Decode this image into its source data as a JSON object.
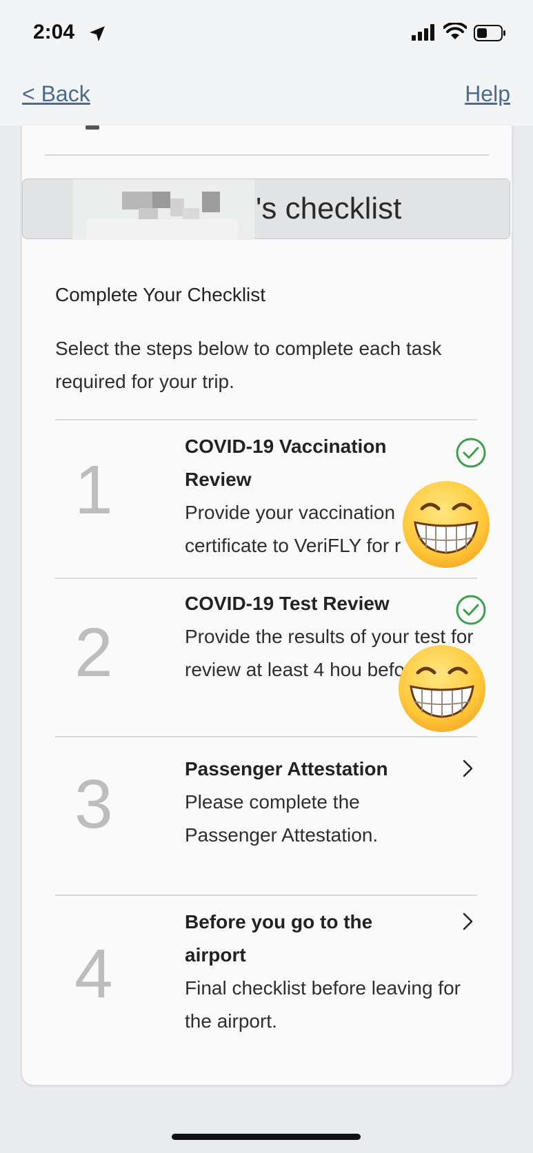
{
  "status_bar": {
    "time": "2:04"
  },
  "nav": {
    "back_label": "< Back",
    "help_label": "Help"
  },
  "header": {
    "title": "'s checklist"
  },
  "section": {
    "title": "Complete Your Checklist",
    "instructions": "Select the steps below to complete each task required for your trip."
  },
  "steps": [
    {
      "number": "1",
      "title": "COVID-19 Vaccination Review",
      "description": "Provide your vaccination certificate to VeriFLY for r",
      "status": "complete"
    },
    {
      "number": "2",
      "title": "COVID-19 Test Review",
      "description": "Provide the results of your test for review at least 4 hou before flight.",
      "status": "complete"
    },
    {
      "number": "3",
      "title": "Passenger Attestation",
      "description": "Please complete the Passenger Attestation.",
      "status": "pending"
    },
    {
      "number": "4",
      "title": "Before you go to the airport",
      "description": "Final checklist before leaving for the airport.",
      "status": "pending"
    }
  ],
  "colors": {
    "accent_link": "#4a6a92",
    "check_green": "#3aa14a",
    "step_number": "#bdbdbd"
  }
}
